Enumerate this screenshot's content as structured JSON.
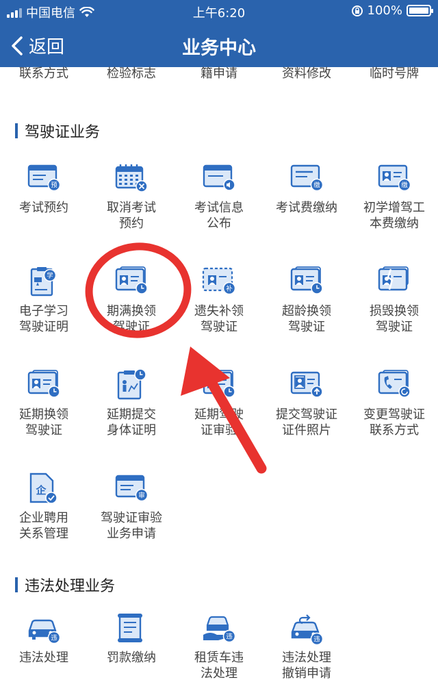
{
  "status_bar": {
    "carrier": "中国电信",
    "time": "上午6:20",
    "battery": "100%",
    "battery_level": 1.0
  },
  "nav": {
    "back_label": "返回",
    "title": "业务中心"
  },
  "prev_row": [
    "联系方式",
    "检验标志",
    "籍申请",
    "资料修改",
    "临时号牌"
  ],
  "sections": [
    {
      "title": "驾驶证业务",
      "items": [
        {
          "lines": [
            "考试预约"
          ],
          "icon": "card-reserve-icon",
          "badge": "预"
        },
        {
          "lines": [
            "取消考试",
            "预约"
          ],
          "icon": "calendar-cancel-icon",
          "badge": ""
        },
        {
          "lines": [
            "考试信息",
            "公布"
          ],
          "icon": "card-announce-icon",
          "badge": ""
        },
        {
          "lines": [
            "考试费缴纳"
          ],
          "icon": "card-pay-icon",
          "badge": "缴"
        },
        {
          "lines": [
            "初学增驾工",
            "本费缴纳"
          ],
          "icon": "id-pay-icon",
          "badge": "缴"
        },
        {
          "lines": [
            "电子学习",
            "驾驶证明"
          ],
          "icon": "clipboard-study-icon",
          "badge": "学"
        },
        {
          "lines": [
            "期满换领",
            "驾驶证"
          ],
          "icon": "license-clock-icon",
          "badge": ""
        },
        {
          "lines": [
            "遗失补领",
            "驾驶证"
          ],
          "icon": "license-replace-icon",
          "badge": "补"
        },
        {
          "lines": [
            "超龄换领",
            "驾驶证"
          ],
          "icon": "license-clock-icon",
          "badge": ""
        },
        {
          "lines": [
            "损毁换领",
            "驾驶证"
          ],
          "icon": "license-damaged-icon",
          "badge": ""
        },
        {
          "lines": [
            "延期换领",
            "驾驶证"
          ],
          "icon": "license-clock-icon",
          "badge": ""
        },
        {
          "lines": [
            "延期提交",
            "身体证明"
          ],
          "icon": "health-report-icon",
          "badge": ""
        },
        {
          "lines": [
            "延期驾驶",
            "证审验"
          ],
          "icon": "license-clock-icon",
          "badge": ""
        },
        {
          "lines": [
            "提交驾驶证",
            "证件照片"
          ],
          "icon": "photo-upload-icon",
          "badge": ""
        },
        {
          "lines": [
            "变更驾驶证",
            "联系方式"
          ],
          "icon": "contact-change-icon",
          "badge": ""
        },
        {
          "lines": [
            "企业聘用",
            "关系管理"
          ],
          "icon": "enterprise-doc-icon",
          "badge": "企"
        },
        {
          "lines": [
            "驾驶证审验",
            "业务申请"
          ],
          "icon": "card-review-icon",
          "badge": "审"
        }
      ]
    },
    {
      "title": "违法处理业务",
      "items": [
        {
          "lines": [
            "违法处理"
          ],
          "icon": "car-violation-icon",
          "badge": "违"
        },
        {
          "lines": [
            "罚款缴纳"
          ],
          "icon": "fine-scroll-icon",
          "badge": ""
        },
        {
          "lines": [
            "租赁车违",
            "法处理"
          ],
          "icon": "rental-car-icon",
          "badge": "违"
        },
        {
          "lines": [
            "违法处理",
            "撤销申请"
          ],
          "icon": "car-undo-icon",
          "badge": "违"
        }
      ]
    }
  ],
  "colors": {
    "primary": "#2a63ad",
    "icon_blue": "#2f6ec2",
    "icon_light": "#dbe8f8",
    "annotation_red": "#e8332f"
  }
}
